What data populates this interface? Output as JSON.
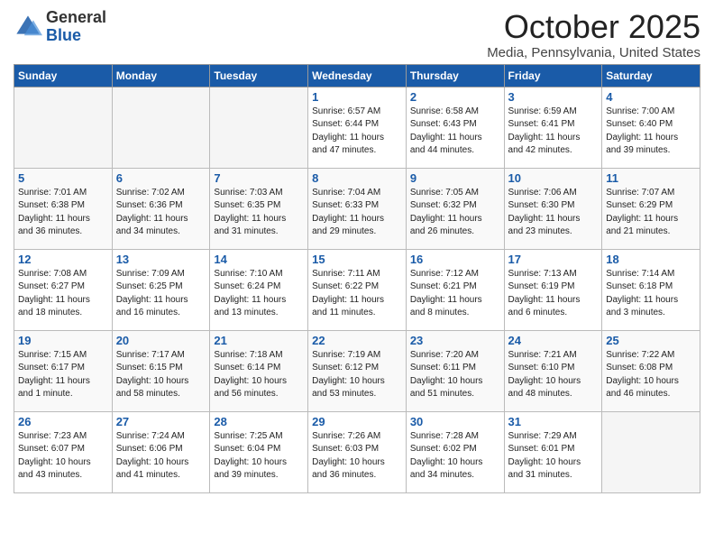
{
  "header": {
    "logo_general": "General",
    "logo_blue": "Blue",
    "month": "October 2025",
    "location": "Media, Pennsylvania, United States"
  },
  "days_of_week": [
    "Sunday",
    "Monday",
    "Tuesday",
    "Wednesday",
    "Thursday",
    "Friday",
    "Saturday"
  ],
  "weeks": [
    [
      {
        "day": "",
        "info": ""
      },
      {
        "day": "",
        "info": ""
      },
      {
        "day": "",
        "info": ""
      },
      {
        "day": "1",
        "info": "Sunrise: 6:57 AM\nSunset: 6:44 PM\nDaylight: 11 hours\nand 47 minutes."
      },
      {
        "day": "2",
        "info": "Sunrise: 6:58 AM\nSunset: 6:43 PM\nDaylight: 11 hours\nand 44 minutes."
      },
      {
        "day": "3",
        "info": "Sunrise: 6:59 AM\nSunset: 6:41 PM\nDaylight: 11 hours\nand 42 minutes."
      },
      {
        "day": "4",
        "info": "Sunrise: 7:00 AM\nSunset: 6:40 PM\nDaylight: 11 hours\nand 39 minutes."
      }
    ],
    [
      {
        "day": "5",
        "info": "Sunrise: 7:01 AM\nSunset: 6:38 PM\nDaylight: 11 hours\nand 36 minutes."
      },
      {
        "day": "6",
        "info": "Sunrise: 7:02 AM\nSunset: 6:36 PM\nDaylight: 11 hours\nand 34 minutes."
      },
      {
        "day": "7",
        "info": "Sunrise: 7:03 AM\nSunset: 6:35 PM\nDaylight: 11 hours\nand 31 minutes."
      },
      {
        "day": "8",
        "info": "Sunrise: 7:04 AM\nSunset: 6:33 PM\nDaylight: 11 hours\nand 29 minutes."
      },
      {
        "day": "9",
        "info": "Sunrise: 7:05 AM\nSunset: 6:32 PM\nDaylight: 11 hours\nand 26 minutes."
      },
      {
        "day": "10",
        "info": "Sunrise: 7:06 AM\nSunset: 6:30 PM\nDaylight: 11 hours\nand 23 minutes."
      },
      {
        "day": "11",
        "info": "Sunrise: 7:07 AM\nSunset: 6:29 PM\nDaylight: 11 hours\nand 21 minutes."
      }
    ],
    [
      {
        "day": "12",
        "info": "Sunrise: 7:08 AM\nSunset: 6:27 PM\nDaylight: 11 hours\nand 18 minutes."
      },
      {
        "day": "13",
        "info": "Sunrise: 7:09 AM\nSunset: 6:25 PM\nDaylight: 11 hours\nand 16 minutes."
      },
      {
        "day": "14",
        "info": "Sunrise: 7:10 AM\nSunset: 6:24 PM\nDaylight: 11 hours\nand 13 minutes."
      },
      {
        "day": "15",
        "info": "Sunrise: 7:11 AM\nSunset: 6:22 PM\nDaylight: 11 hours\nand 11 minutes."
      },
      {
        "day": "16",
        "info": "Sunrise: 7:12 AM\nSunset: 6:21 PM\nDaylight: 11 hours\nand 8 minutes."
      },
      {
        "day": "17",
        "info": "Sunrise: 7:13 AM\nSunset: 6:19 PM\nDaylight: 11 hours\nand 6 minutes."
      },
      {
        "day": "18",
        "info": "Sunrise: 7:14 AM\nSunset: 6:18 PM\nDaylight: 11 hours\nand 3 minutes."
      }
    ],
    [
      {
        "day": "19",
        "info": "Sunrise: 7:15 AM\nSunset: 6:17 PM\nDaylight: 11 hours\nand 1 minute."
      },
      {
        "day": "20",
        "info": "Sunrise: 7:17 AM\nSunset: 6:15 PM\nDaylight: 10 hours\nand 58 minutes."
      },
      {
        "day": "21",
        "info": "Sunrise: 7:18 AM\nSunset: 6:14 PM\nDaylight: 10 hours\nand 56 minutes."
      },
      {
        "day": "22",
        "info": "Sunrise: 7:19 AM\nSunset: 6:12 PM\nDaylight: 10 hours\nand 53 minutes."
      },
      {
        "day": "23",
        "info": "Sunrise: 7:20 AM\nSunset: 6:11 PM\nDaylight: 10 hours\nand 51 minutes."
      },
      {
        "day": "24",
        "info": "Sunrise: 7:21 AM\nSunset: 6:10 PM\nDaylight: 10 hours\nand 48 minutes."
      },
      {
        "day": "25",
        "info": "Sunrise: 7:22 AM\nSunset: 6:08 PM\nDaylight: 10 hours\nand 46 minutes."
      }
    ],
    [
      {
        "day": "26",
        "info": "Sunrise: 7:23 AM\nSunset: 6:07 PM\nDaylight: 10 hours\nand 43 minutes."
      },
      {
        "day": "27",
        "info": "Sunrise: 7:24 AM\nSunset: 6:06 PM\nDaylight: 10 hours\nand 41 minutes."
      },
      {
        "day": "28",
        "info": "Sunrise: 7:25 AM\nSunset: 6:04 PM\nDaylight: 10 hours\nand 39 minutes."
      },
      {
        "day": "29",
        "info": "Sunrise: 7:26 AM\nSunset: 6:03 PM\nDaylight: 10 hours\nand 36 minutes."
      },
      {
        "day": "30",
        "info": "Sunrise: 7:28 AM\nSunset: 6:02 PM\nDaylight: 10 hours\nand 34 minutes."
      },
      {
        "day": "31",
        "info": "Sunrise: 7:29 AM\nSunset: 6:01 PM\nDaylight: 10 hours\nand 31 minutes."
      },
      {
        "day": "",
        "info": ""
      }
    ]
  ]
}
